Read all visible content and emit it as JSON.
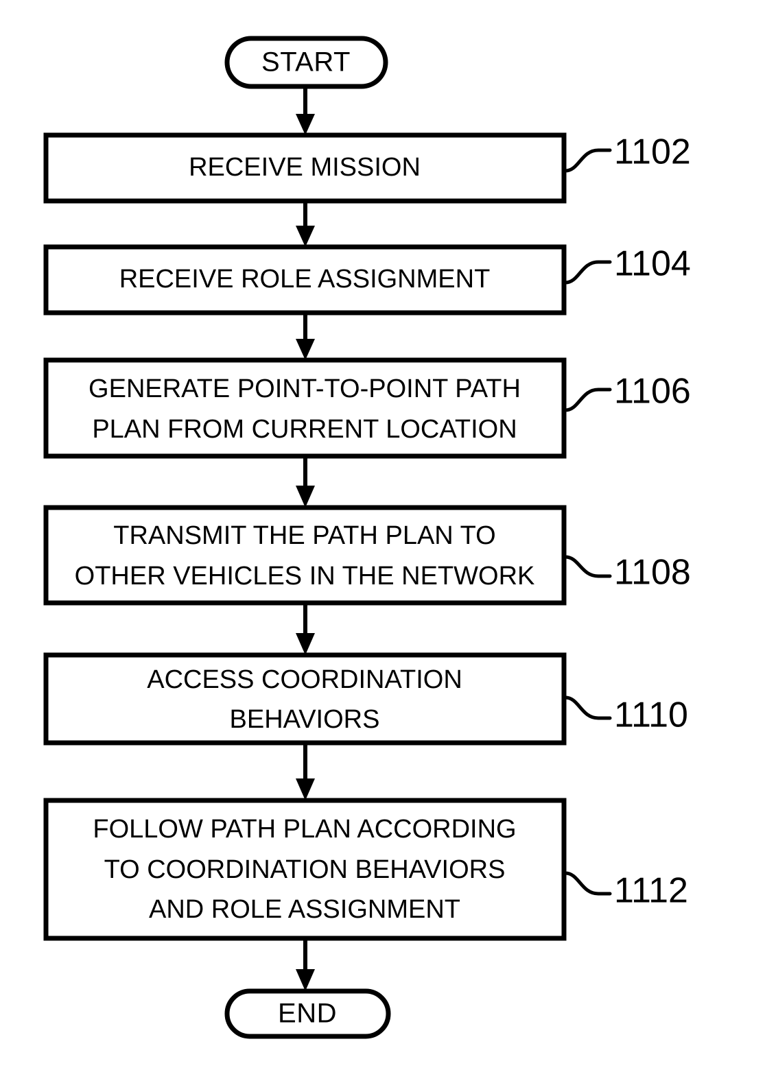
{
  "figure": {
    "type": "flowchart",
    "orientation": "vertical",
    "background_color": "#ffffff",
    "line_color": "#000000"
  },
  "nodes": {
    "start": {
      "label": "START",
      "shape": "terminator"
    },
    "end": {
      "label": "END",
      "shape": "terminator"
    },
    "steps": [
      {
        "ref": "1102",
        "shape": "process",
        "lines": [
          "RECEIVE MISSION"
        ]
      },
      {
        "ref": "1104",
        "shape": "process",
        "lines": [
          "RECEIVE ROLE ASSIGNMENT"
        ]
      },
      {
        "ref": "1106",
        "shape": "process",
        "lines": [
          "GENERATE POINT-TO-POINT PATH",
          "PLAN FROM CURRENT LOCATION"
        ]
      },
      {
        "ref": "1108",
        "shape": "process",
        "lines": [
          "TRANSMIT THE PATH PLAN TO",
          "OTHER VEHICLES IN THE NETWORK"
        ]
      },
      {
        "ref": "1110",
        "shape": "process",
        "lines": [
          "ACCESS COORDINATION",
          "BEHAVIORS"
        ]
      },
      {
        "ref": "1112",
        "shape": "process",
        "lines": [
          "FOLLOW PATH PLAN ACCORDING",
          "TO COORDINATION BEHAVIORS",
          "AND ROLE ASSIGNMENT"
        ]
      }
    ]
  },
  "flow_sequence": [
    "START",
    "1102",
    "1104",
    "1106",
    "1108",
    "1110",
    "1112",
    "END"
  ]
}
